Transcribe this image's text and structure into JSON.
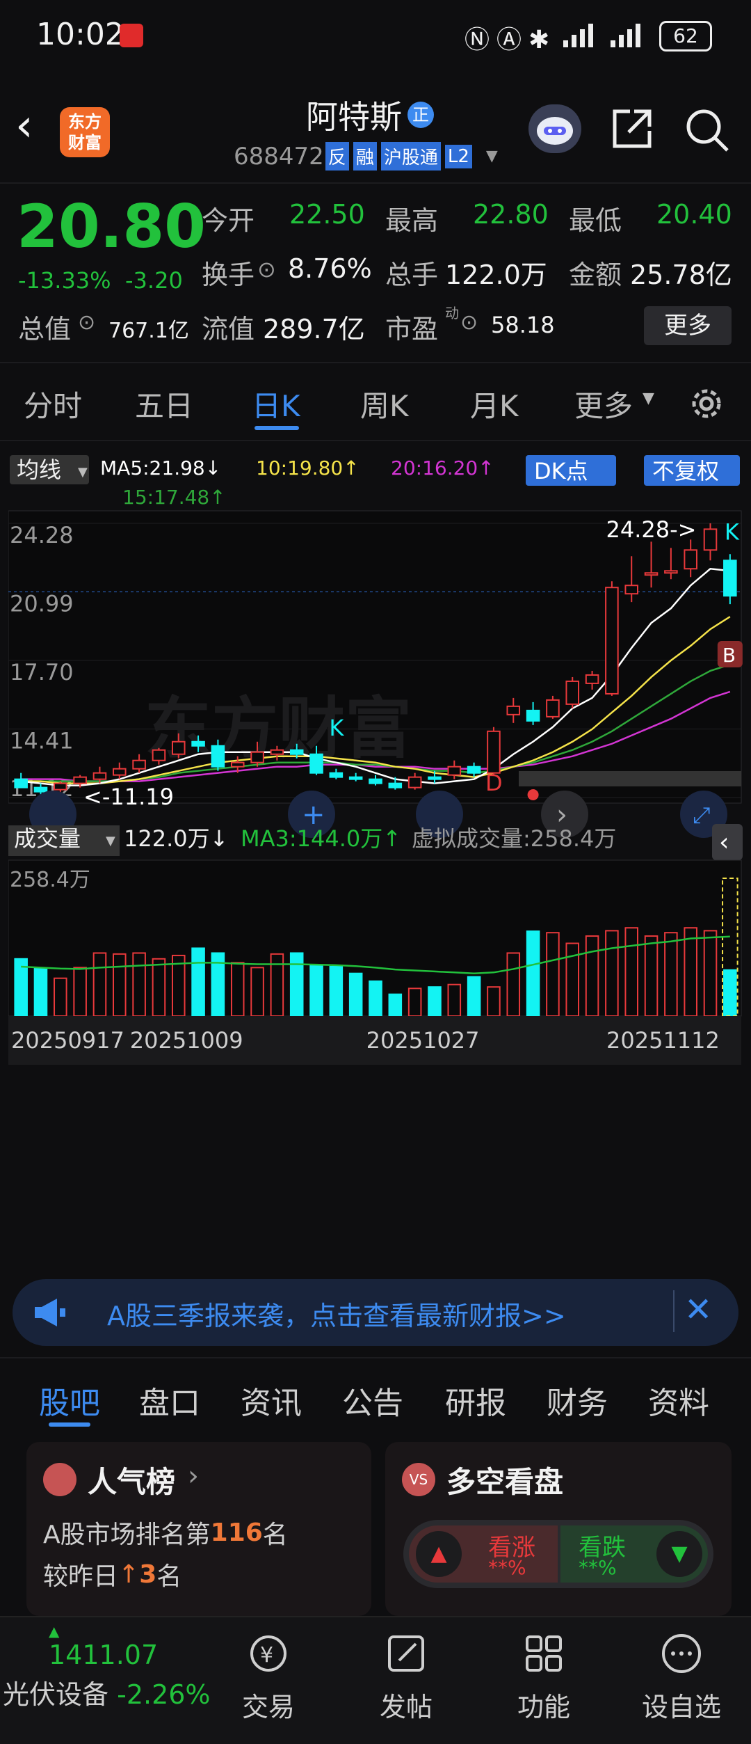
{
  "status_bar": {
    "time": "10:02",
    "battery": "62"
  },
  "header": {
    "logo_line1": "东方",
    "logo_line2": "财富",
    "name": "阿特斯",
    "name_badge": "正",
    "code": "688472",
    "tags": [
      "反",
      "融",
      "沪股通",
      "L2"
    ]
  },
  "quote": {
    "price": "20.80",
    "change_pct": "-13.33%",
    "change": "-3.20",
    "open_label": "今开",
    "open": "22.50",
    "high_label": "最高",
    "high": "22.80",
    "low_label": "最低",
    "low": "20.40",
    "turnover_label": "换手",
    "turnover": "8.76%",
    "volume_label": "总手",
    "volume": "122.0万",
    "amount_label": "金额",
    "amount": "25.78亿",
    "mktcap_label": "总值",
    "mktcap": "767.1亿",
    "float_label": "流值",
    "float_cap": "289.7亿",
    "pe_label": "市盈",
    "pe_sup": "动",
    "pe": "58.18",
    "more": "更多"
  },
  "tabs": [
    "分时",
    "五日",
    "日K",
    "周K",
    "月K",
    "更多"
  ],
  "active_tab": "日K",
  "chart_header": {
    "indicator": "均线",
    "ma5": "MA5:21.98↓",
    "ma10": "10:19.80↑",
    "ma20": "20:16.20↑",
    "ma15": "15:17.48↑",
    "dk_button": "DK点",
    "rights_button": "不复权",
    "max_annot": "24.28->",
    "min_annot": "<-11.19",
    "k_mark": "K",
    "d_mark": "D",
    "b_mark": "B",
    "watermark": "东方财富"
  },
  "volume_header": {
    "indicator": "成交量",
    "volume": "122.0万↓",
    "ma3": "MA3:144.0万↑",
    "virtual": "虚拟成交量:258.4万",
    "axis_max": "258.4万"
  },
  "colors": {
    "up": "#e8393b",
    "down": "#13f3f3",
    "ma5": "#ffffff",
    "ma10": "#f5e34a",
    "ma20": "#d335d3",
    "ma15": "#2fa83a",
    "accent": "#3d8bf0"
  },
  "chart_data": {
    "type": "candlestick",
    "price_axis_ticks": [
      "24.28",
      "20.99",
      "17.70",
      "14.41",
      "11.12"
    ],
    "ylim": [
      11.12,
      24.28
    ],
    "x_tick_labels": [
      "20250917",
      "20251009",
      "20251027",
      "20251112"
    ],
    "candles": [
      {
        "o": 12.0,
        "h": 12.3,
        "l": 11.7,
        "c": 11.6
      },
      {
        "o": 11.6,
        "h": 11.8,
        "l": 11.19,
        "c": 11.4
      },
      {
        "o": 11.5,
        "h": 11.9,
        "l": 11.3,
        "c": 11.8
      },
      {
        "o": 11.8,
        "h": 12.2,
        "l": 11.6,
        "c": 12.1
      },
      {
        "o": 12.0,
        "h": 12.6,
        "l": 11.8,
        "c": 12.3
      },
      {
        "o": 12.2,
        "h": 12.8,
        "l": 12.0,
        "c": 12.5
      },
      {
        "o": 12.5,
        "h": 13.2,
        "l": 12.3,
        "c": 12.9
      },
      {
        "o": 12.9,
        "h": 13.5,
        "l": 12.7,
        "c": 13.4
      },
      {
        "o": 13.2,
        "h": 14.2,
        "l": 13.0,
        "c": 13.8
      },
      {
        "o": 13.8,
        "h": 14.1,
        "l": 13.3,
        "c": 13.6
      },
      {
        "o": 13.6,
        "h": 13.9,
        "l": 12.4,
        "c": 12.6
      },
      {
        "o": 12.6,
        "h": 13.1,
        "l": 12.3,
        "c": 12.8
      },
      {
        "o": 12.8,
        "h": 13.8,
        "l": 12.6,
        "c": 13.3
      },
      {
        "o": 13.2,
        "h": 13.6,
        "l": 12.9,
        "c": 13.4
      },
      {
        "o": 13.4,
        "h": 13.7,
        "l": 13.0,
        "c": 13.2
      },
      {
        "o": 13.2,
        "h": 13.6,
        "l": 12.2,
        "c": 12.3
      },
      {
        "o": 12.3,
        "h": 12.5,
        "l": 12.0,
        "c": 12.1
      },
      {
        "o": 12.1,
        "h": 12.3,
        "l": 11.9,
        "c": 12.0
      },
      {
        "o": 12.0,
        "h": 12.2,
        "l": 11.7,
        "c": 11.8
      },
      {
        "o": 11.8,
        "h": 12.1,
        "l": 11.5,
        "c": 11.6
      },
      {
        "o": 11.6,
        "h": 12.3,
        "l": 11.5,
        "c": 12.1
      },
      {
        "o": 12.1,
        "h": 12.4,
        "l": 11.8,
        "c": 12.0
      },
      {
        "o": 12.2,
        "h": 12.9,
        "l": 12.0,
        "c": 12.6
      },
      {
        "o": 12.6,
        "h": 12.8,
        "l": 12.1,
        "c": 12.3
      },
      {
        "o": 12.3,
        "h": 14.5,
        "l": 12.2,
        "c": 14.3
      },
      {
        "o": 15.1,
        "h": 15.9,
        "l": 14.7,
        "c": 15.5
      },
      {
        "o": 15.3,
        "h": 15.7,
        "l": 14.6,
        "c": 14.8
      },
      {
        "o": 15.0,
        "h": 16.0,
        "l": 14.9,
        "c": 15.8
      },
      {
        "o": 15.6,
        "h": 16.9,
        "l": 15.4,
        "c": 16.7
      },
      {
        "o": 16.6,
        "h": 17.2,
        "l": 16.3,
        "c": 17.0
      },
      {
        "o": 16.1,
        "h": 21.5,
        "l": 16.0,
        "c": 21.2
      },
      {
        "o": 20.9,
        "h": 22.7,
        "l": 20.5,
        "c": 21.3
      },
      {
        "o": 21.8,
        "h": 23.4,
        "l": 21.2,
        "c": 21.9
      },
      {
        "o": 21.9,
        "h": 23.1,
        "l": 21.6,
        "c": 22.0
      },
      {
        "o": 22.1,
        "h": 23.5,
        "l": 21.7,
        "c": 23.0
      },
      {
        "o": 23.0,
        "h": 24.28,
        "l": 22.5,
        "c": 24.0
      },
      {
        "o": 22.5,
        "h": 22.8,
        "l": 20.4,
        "c": 20.8
      }
    ],
    "ma5": [
      11.9,
      11.8,
      11.7,
      11.7,
      11.8,
      12.0,
      12.3,
      12.6,
      12.9,
      13.2,
      13.3,
      13.3,
      13.3,
      13.3,
      13.3,
      13.0,
      12.8,
      12.6,
      12.3,
      12.0,
      11.9,
      11.8,
      11.9,
      12.0,
      12.5,
      13.2,
      13.8,
      14.5,
      15.4,
      15.9,
      17.0,
      18.3,
      19.5,
      20.2,
      21.3,
      22.1,
      22.0
    ],
    "ma10": [
      11.9,
      11.9,
      11.8,
      11.8,
      11.8,
      11.9,
      12.0,
      12.2,
      12.4,
      12.6,
      12.8,
      12.9,
      13.0,
      13.1,
      13.1,
      13.1,
      13.0,
      12.9,
      12.8,
      12.6,
      12.5,
      12.3,
      12.2,
      12.1,
      12.3,
      12.6,
      12.9,
      13.3,
      13.8,
      14.4,
      15.2,
      16.0,
      16.9,
      17.7,
      18.4,
      19.2,
      19.8
    ],
    "ma15": [
      11.9,
      11.9,
      11.9,
      11.9,
      11.9,
      11.9,
      12.0,
      12.1,
      12.3,
      12.4,
      12.5,
      12.6,
      12.7,
      12.8,
      12.8,
      12.8,
      12.8,
      12.7,
      12.7,
      12.6,
      12.5,
      12.4,
      12.4,
      12.3,
      12.4,
      12.6,
      12.8,
      13.1,
      13.4,
      13.8,
      14.3,
      14.9,
      15.5,
      16.1,
      16.7,
      17.2,
      17.5
    ],
    "ma20": [
      12.0,
      12.0,
      12.0,
      11.9,
      11.9,
      11.9,
      11.9,
      12.0,
      12.1,
      12.2,
      12.3,
      12.4,
      12.5,
      12.6,
      12.6,
      12.7,
      12.7,
      12.7,
      12.6,
      12.6,
      12.6,
      12.5,
      12.5,
      12.5,
      12.5,
      12.6,
      12.7,
      12.9,
      13.1,
      13.4,
      13.7,
      14.1,
      14.5,
      14.9,
      15.4,
      15.9,
      16.2
    ],
    "volumes": [
      118,
      98,
      78,
      100,
      130,
      128,
      130,
      118,
      125,
      140,
      130,
      110,
      100,
      128,
      130,
      105,
      102,
      88,
      72,
      45,
      57,
      60,
      65,
      81,
      60,
      130,
      175,
      172,
      150,
      165,
      176,
      182,
      165,
      172,
      182,
      176,
      95
    ],
    "volume_ma3": [
      102,
      100,
      98,
      97,
      100,
      102,
      104,
      106,
      108,
      110,
      110,
      108,
      107,
      107,
      107,
      106,
      105,
      103,
      100,
      96,
      94,
      92,
      90,
      88,
      90,
      97,
      106,
      115,
      124,
      133,
      140,
      145,
      150,
      154,
      160,
      162,
      164
    ],
    "volume_ylim": [
      0,
      258.4
    ]
  },
  "banner": {
    "text": "A股三季报来袭，点击查看最新财报>>"
  },
  "bottom_tabs": [
    "股吧",
    "盘口",
    "资讯",
    "公告",
    "研报",
    "财务",
    "资料"
  ],
  "rank_card": {
    "title": "人气榜",
    "line1_prefix": "A股市场排名第",
    "rank": "116",
    "line1_suffix": "名",
    "line2_prefix": "较昨日",
    "change": "3",
    "line2_suffix": "名"
  },
  "sentiment_card": {
    "title": "多空看盘",
    "bull": "看涨",
    "bull_value": "**%",
    "bear": "看跌",
    "bear_value": "**%"
  },
  "bottom_nav": {
    "index_value": "1411.07",
    "index_name": "光伏设备",
    "index_change": "-2.26%",
    "items": [
      "交易",
      "发帖",
      "功能",
      "设自选"
    ]
  }
}
